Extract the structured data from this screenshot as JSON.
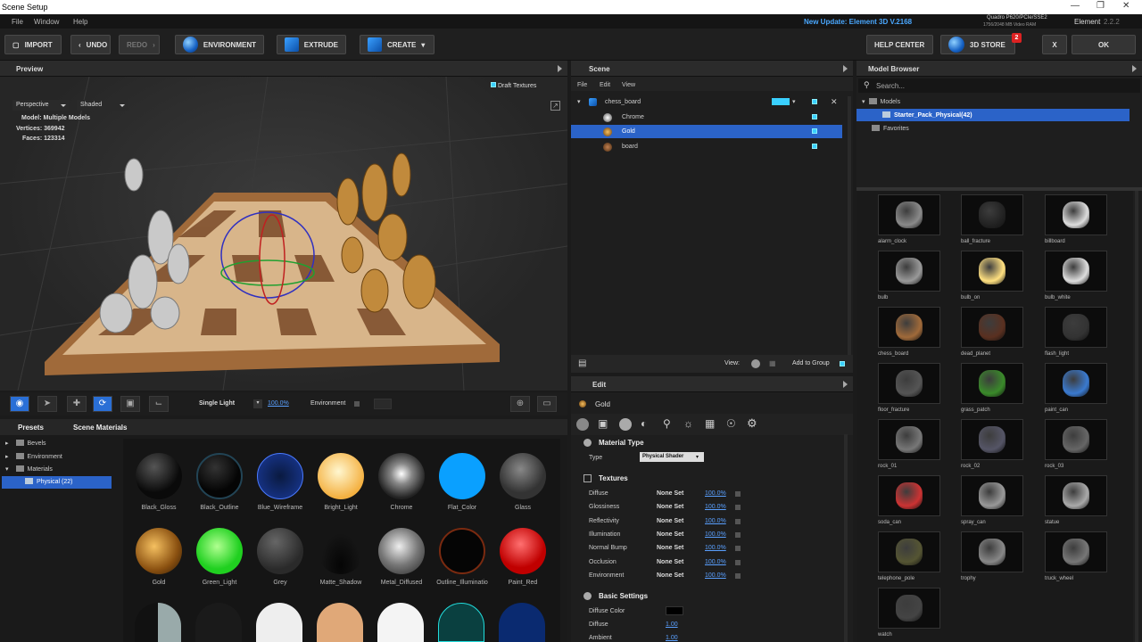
{
  "window": {
    "title": "Scene Setup"
  },
  "menu": [
    "File",
    "Window",
    "Help"
  ],
  "header": {
    "update": "New Update: Element 3D V.2168",
    "gpu_line1": "Quadro P620/PCIe/SSE2",
    "gpu_line2": "1756/2048 MB Video RAM",
    "app_name": "Element",
    "app_version": "2.2.2"
  },
  "toolbar": {
    "import": "IMPORT",
    "undo": "UNDO",
    "redo": "REDO",
    "environment": "ENVIRONMENT",
    "extrude": "EXTRUDE",
    "create": "CREATE",
    "help_center": "HELP CENTER",
    "store": "3D STORE",
    "store_badge": "2",
    "close": "X",
    "ok": "OK"
  },
  "preview": {
    "title": "Preview",
    "draft_textures": "Draft Textures",
    "perspective": "Perspective",
    "shaded": "Shaded",
    "stats": {
      "model": "Model:  Multiple Models",
      "vertices": "Vertices:  369942",
      "faces": "Faces:  123314"
    },
    "light_mode": "Single Light",
    "light_pct": "100.0%",
    "environment": "Environment"
  },
  "presets": {
    "tab1": "Presets",
    "tab2": "Scene Materials",
    "tree": [
      "Bevels",
      "Environment",
      "Materials",
      "Physical (22)"
    ],
    "materials": [
      "Black_Gloss",
      "Black_Outline",
      "Blue_Wireframe",
      "Bright_Light",
      "Chrome",
      "Flat_Color",
      "Glass",
      "Gold",
      "Green_Light",
      "Grey",
      "Matte_Shadow",
      "Metal_Diffused",
      "Outline_Illuminatio",
      "Paint_Red"
    ]
  },
  "scene": {
    "title": "Scene",
    "menu": [
      "File",
      "Edit",
      "View"
    ],
    "root": "chess_board",
    "items": [
      "Chrome",
      "Gold",
      "board"
    ],
    "view_label": "View:",
    "add_to_group": "Add to Group"
  },
  "edit": {
    "title": "Edit",
    "material": "Gold",
    "material_type_header": "Material Type",
    "type_label": "Type",
    "type_value": "Physical Shader",
    "textures_header": "Textures",
    "textures": [
      {
        "name": "Diffuse",
        "value": "None Set",
        "pct": "100.0%"
      },
      {
        "name": "Glossiness",
        "value": "None Set",
        "pct": "100.0%"
      },
      {
        "name": "Reflectivity",
        "value": "None Set",
        "pct": "100.0%"
      },
      {
        "name": "Illumination",
        "value": "None Set",
        "pct": "100.0%"
      },
      {
        "name": "Normal Bump",
        "value": "None Set",
        "pct": "100.0%"
      },
      {
        "name": "Occlusion",
        "value": "None Set",
        "pct": "100.0%"
      },
      {
        "name": "Environment",
        "value": "None Set",
        "pct": "100.0%"
      }
    ],
    "basic_header": "Basic Settings",
    "diffuse_color": "Diffuse Color",
    "diffuse": "Diffuse",
    "diffuse_val": "1.00",
    "ambient": "Ambient",
    "ambient_val": "1.00"
  },
  "browser": {
    "title": "Model Browser",
    "search_placeholder": "Search...",
    "tree": [
      "Models",
      "Starter_Pack_Physical(42)",
      "Favorites"
    ],
    "models": [
      "alarm_clock",
      "ball_fracture",
      "billboard",
      "bulb",
      "bulb_on",
      "bulb_white",
      "chess_board",
      "dead_planet",
      "flash_light",
      "floor_fracture",
      "grass_patch",
      "paint_can",
      "rock_01",
      "rock_02",
      "rock_03",
      "soda_can",
      "spray_can",
      "statue",
      "telephone_pole",
      "trophy",
      "truck_wheel",
      "watch"
    ]
  }
}
